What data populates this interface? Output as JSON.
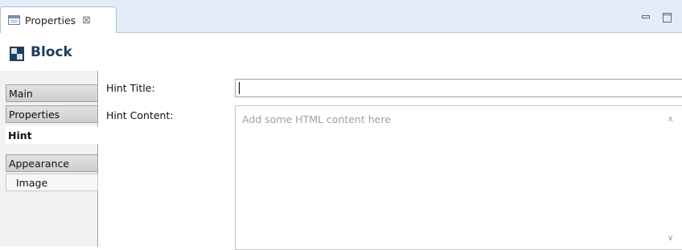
{
  "view": {
    "tab_label": "Properties",
    "tab_icon": "properties-view-icon",
    "close_glyph": "⊠",
    "minimize_icon": "minimize-icon",
    "maximize_icon": "maximize-icon"
  },
  "header": {
    "title": "Block",
    "icon": "block-icon"
  },
  "sections": {
    "items": [
      {
        "label": "Main",
        "selected": false
      },
      {
        "label": "Properties",
        "selected": false
      },
      {
        "label": "Hint",
        "selected": true
      },
      {
        "label": "Appearance",
        "selected": false
      },
      {
        "label": "Image",
        "selected": false
      }
    ]
  },
  "form": {
    "hint_title_label": "Hint Title:",
    "hint_title_value": "",
    "hint_content_label": "Hint Content:",
    "hint_content_value": "",
    "hint_content_placeholder": "Add some HTML content here"
  },
  "colors": {
    "tabbar_bg": "#e4ecf7",
    "title_color": "#1e3c5e",
    "selected_tab_bg": "#ffffff"
  }
}
